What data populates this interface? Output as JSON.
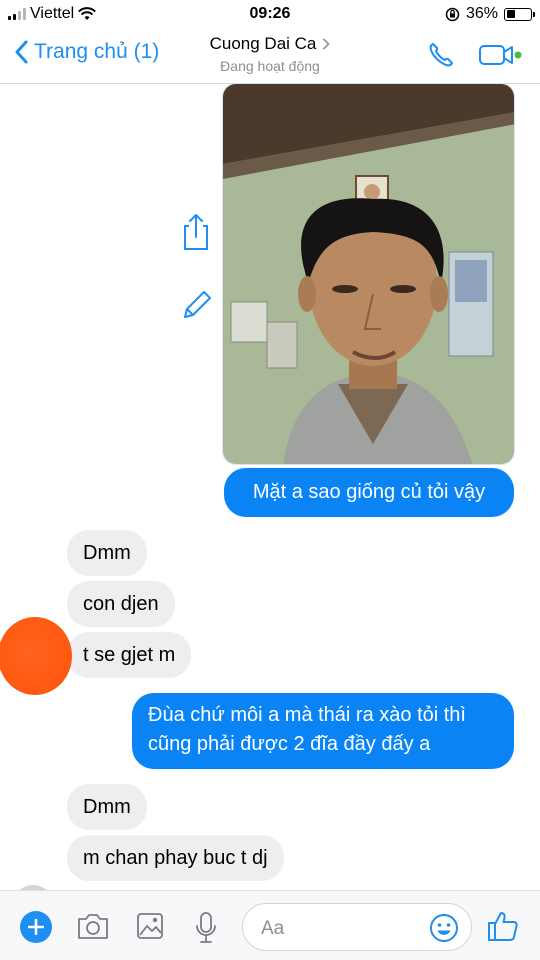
{
  "status_bar": {
    "carrier": "Viettel",
    "time": "09:26",
    "battery_percent": "36%",
    "battery_level": 0.36,
    "signal_bars_filled": 2,
    "signal_bars_total": 4
  },
  "header": {
    "back_label": "Trang chủ (1)",
    "contact_name": "Cuong Dai Ca",
    "contact_status": "Đang hoạt động",
    "icons": [
      "phone-icon",
      "video-call-icon"
    ],
    "accent_color": "#1f8ef1",
    "online_color": "#44bf3a"
  },
  "messages": [
    {
      "from": "me",
      "type": "image",
      "alt_icon": "selfie-photo"
    },
    {
      "from": "me",
      "type": "text",
      "text": "Mặt a sao giống củ tỏi vậy"
    },
    {
      "from": "them",
      "type": "text",
      "text": "Dmm"
    },
    {
      "from": "them",
      "type": "text",
      "text": "con djen"
    },
    {
      "from": "them",
      "type": "text",
      "text": "t se gjet m"
    },
    {
      "from": "me",
      "type": "text",
      "lines": [
        "Đùa chứ môi a mà thái ra xào tỏi thì",
        "cũng phải được 2 đĩa đầy đấy a"
      ]
    },
    {
      "from": "them",
      "type": "text",
      "text": "Dmm"
    },
    {
      "from": "them",
      "type": "text",
      "text": "m chan phay buc t dj"
    }
  ],
  "photo_actions": [
    "share-icon",
    "edit-icon"
  ],
  "composer": {
    "placeholder": "Aa",
    "icons": [
      "plus-icon",
      "camera-icon",
      "gallery-icon",
      "microphone-icon",
      "emoji-icon",
      "thumbs-up-icon"
    ]
  },
  "colors": {
    "outgoing_bubble": "#0a84f5",
    "incoming_bubble": "#eeeeee"
  }
}
